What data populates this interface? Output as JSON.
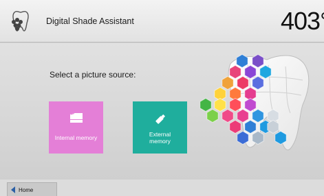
{
  "header": {
    "app_icon": "tooth-shade-icon",
    "title": "Digital Shade Assistant",
    "temperature": "403°"
  },
  "main": {
    "prompt": "Select a picture source:",
    "sources": [
      {
        "label": "Internal memory",
        "icon": "memory-card-icon",
        "color": "#e47fd7"
      },
      {
        "label": "External memory",
        "icon": "usb-stick-icon",
        "color": "#1fae9d"
      }
    ],
    "illustration": "tooth-hexagon-shade-graphic"
  },
  "footer": {
    "home_label": "Home",
    "home_icon": "back-arrow-icon"
  }
}
